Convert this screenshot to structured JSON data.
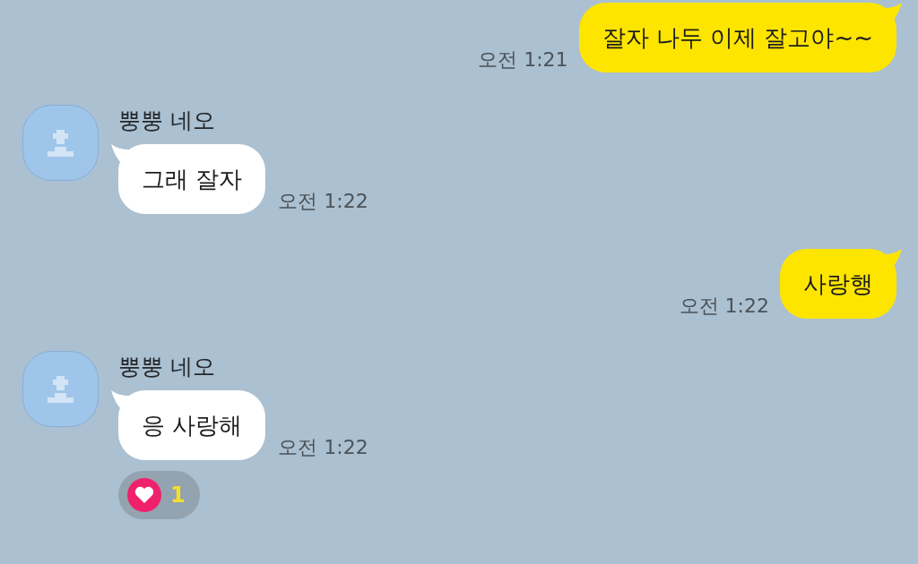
{
  "messages": [
    {
      "kind": "sent",
      "text": "잘자 나두 이제 잘고야~~",
      "time": "오전 1:21"
    },
    {
      "kind": "received",
      "sender": "뿡뿡 네오",
      "text": "그래 잘자",
      "time": "오전 1:22"
    },
    {
      "kind": "sent",
      "text": "사랑행",
      "time": "오전 1:22"
    },
    {
      "kind": "received",
      "sender": "뿡뿡 네오",
      "text": "응 사랑해",
      "time": "오전 1:22",
      "reaction": {
        "count": "1"
      }
    }
  ]
}
